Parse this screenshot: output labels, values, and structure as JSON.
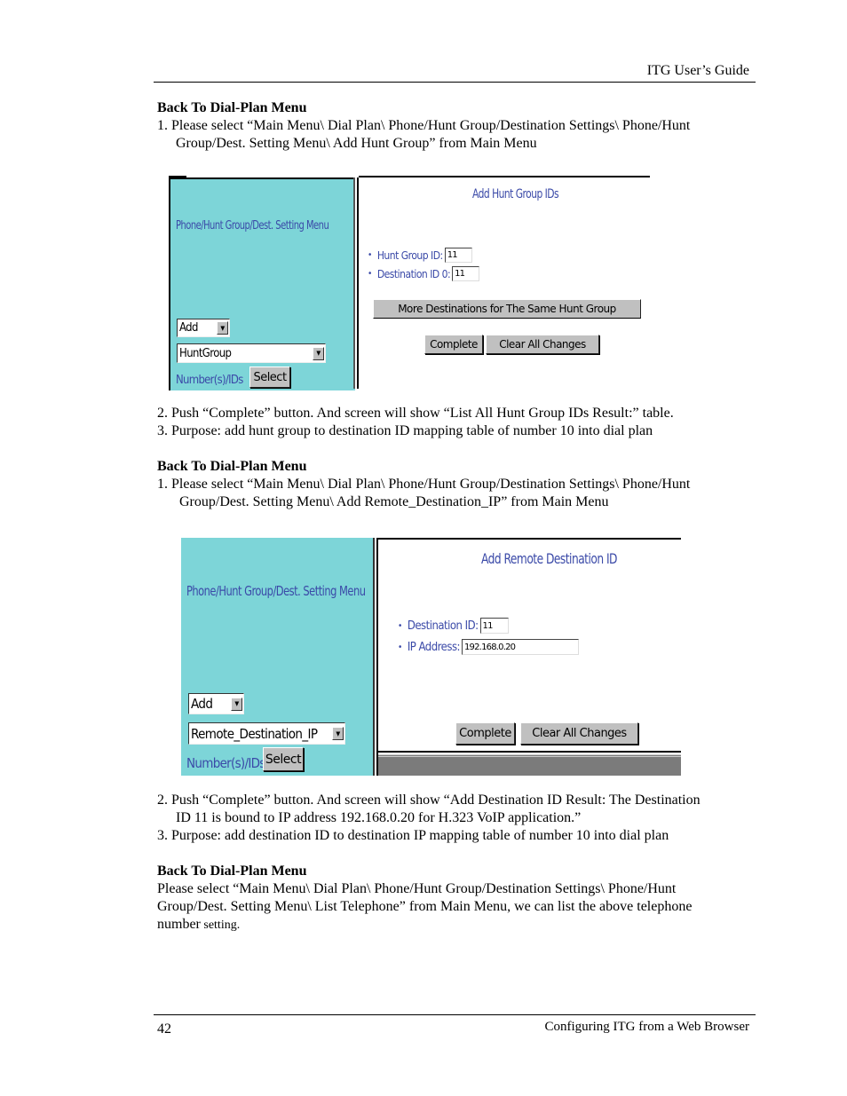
{
  "header": {
    "title": "ITG User’s Guide"
  },
  "footer": {
    "page_number": "42",
    "chapter": "Configuring ITG from a Web Browser"
  },
  "sections": [
    {
      "heading": "Back To Dial-Plan Menu",
      "step1_line1": "1. Please select “Main Menu\\ Dial Plan\\ Phone/Hunt Group/Destination Settings\\ Phone/Hunt",
      "step1_line2": "Group/Dest. Setting Menu\\ Add Hunt Group” from Main Menu",
      "step2": "2. Push “Complete” button. And screen will show “List All Hunt Group IDs Result:” table.",
      "step3": "3. Purpose: add hunt group to destination ID mapping table of number 10 into dial plan"
    },
    {
      "heading": "Back To Dial-Plan Menu",
      "step1_line1": "1. Please select “Main Menu\\ Dial Plan\\ Phone/Hunt Group/Destination Settings\\ Phone/Hunt",
      "step1_line2": "Group/Dest. Setting Menu\\ Add Remote_Destination_IP” from Main Menu",
      "step2_line1": "2. Push “Complete” button. And screen will show “Add Destination ID Result: The Destination",
      "step2_line2": "ID 11 is bound to IP address 192.168.0.20 for H.323 VoIP application.”",
      "step3": "3. Purpose: add destination ID to destination IP mapping table of number 10 into dial plan"
    },
    {
      "heading": "Back To Dial-Plan Menu",
      "line1": "Please select “Main Menu\\ Dial Plan\\ Phone/Hunt Group/Destination Settings\\ Phone/Hunt",
      "line2": "Group/Dest. Setting Menu\\ List Telephone” from Main Menu, we can list the above telephone",
      "line3_a": "number",
      "line3_b": " setting."
    }
  ],
  "screenshot1": {
    "menu_title": "Phone/Hunt Group/Dest. Setting Menu",
    "action_select": "Add",
    "type_select": "HuntGroup",
    "numbers_label": "Number(s)/IDs",
    "select_button": "Select",
    "pane_title": "Add Hunt Group IDs",
    "fields": [
      {
        "label": "Hunt Group ID:",
        "value": "11"
      },
      {
        "label": "Destination ID 0:",
        "value": "11"
      }
    ],
    "more_button": "More Destinations for The Same Hunt Group",
    "complete_button": "Complete",
    "clear_button": "Clear All Changes"
  },
  "screenshot2": {
    "menu_title": "Phone/Hunt Group/Dest. Setting Menu",
    "action_select": "Add",
    "type_select": "Remote_Destination_IP",
    "numbers_label": "Number(s)/IDs",
    "select_button": "Select",
    "pane_title": "Add Remote Destination ID",
    "fields": [
      {
        "label": "Destination ID:",
        "value": "11"
      },
      {
        "label": "IP Address:",
        "value": "192.168.0.20"
      }
    ],
    "complete_button": "Complete",
    "clear_button": "Clear All Changes"
  },
  "icons": {
    "bullet": "•",
    "dropdown_arrow": "▼"
  }
}
